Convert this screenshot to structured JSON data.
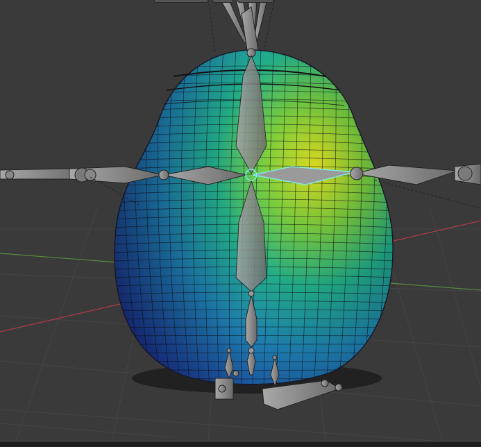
{
  "viewport": {
    "background_color": "#3a3a3a",
    "grid_color": "#444444",
    "x_axis_color": "#b03a4a",
    "y_axis_color": "#5a8a3a",
    "weight_gradient": [
      "#1a2a8a",
      "#1e7fb0",
      "#22b08a",
      "#7ad040",
      "#e8e820"
    ],
    "selected_bone_color": "#7fe8e8",
    "bone_color": "#8c8c8c"
  },
  "header": {
    "widget_1_icon": "pivot-icon",
    "widget_2_icon": "snap-icon",
    "widget_3_icon": "proportional-edit-icon"
  }
}
